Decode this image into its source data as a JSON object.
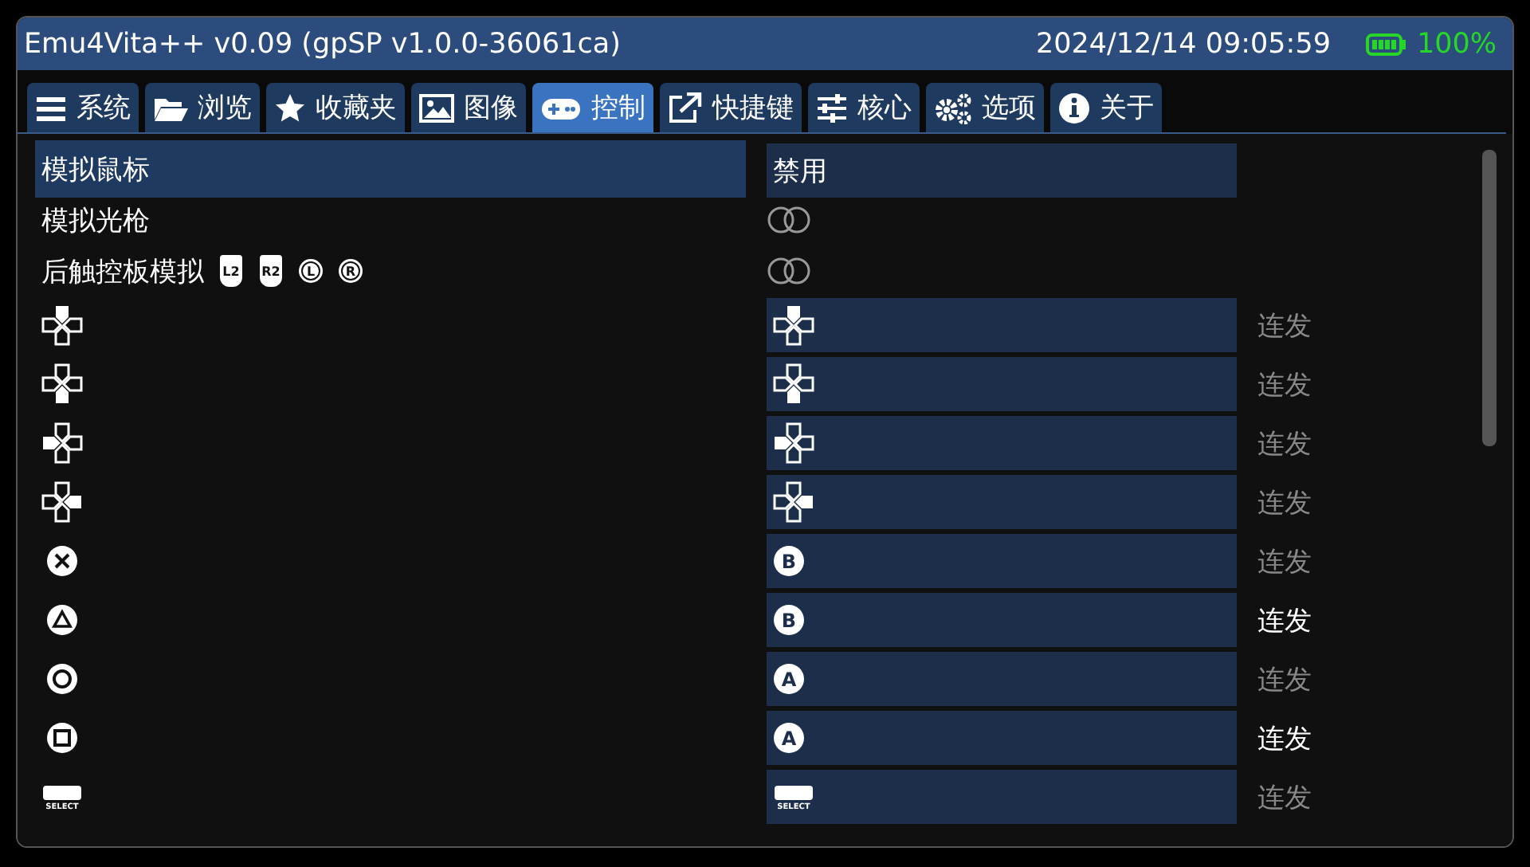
{
  "window": {
    "title": "Emu4Vita++ v0.09 (gpSP v1.0.0-36061ca)",
    "datetime": "2024/12/14 09:05:59",
    "battery": "100%"
  },
  "tabs": [
    {
      "label": "系统",
      "kind": "menu",
      "selected": false
    },
    {
      "label": "浏览",
      "kind": "folder",
      "selected": false
    },
    {
      "label": "收藏夹",
      "kind": "star",
      "selected": false
    },
    {
      "label": "图像",
      "kind": "image",
      "selected": false
    },
    {
      "label": "控制",
      "kind": "gamepad",
      "selected": true
    },
    {
      "label": "快捷键",
      "kind": "external",
      "selected": false
    },
    {
      "label": "核心",
      "kind": "sliders",
      "selected": false
    },
    {
      "label": "选项",
      "kind": "gears",
      "selected": false
    },
    {
      "label": "关于",
      "kind": "info",
      "selected": false
    }
  ],
  "settings": [
    {
      "kind": "option",
      "label": "模拟鼠标",
      "value": "禁用",
      "selected": true
    },
    {
      "kind": "toggle",
      "label": "模拟光枪",
      "on": false,
      "selected": false
    },
    {
      "kind": "toggle",
      "label": "后触控板模拟",
      "on": false,
      "selected": false,
      "buttons": [
        {
          "kind": "shoulder",
          "glyph": "L2"
        },
        {
          "kind": "shoulder",
          "glyph": "R2"
        },
        {
          "kind": "ring",
          "glyph": "L"
        },
        {
          "kind": "ring",
          "glyph": "R"
        }
      ]
    }
  ],
  "mappings": [
    {
      "source": {
        "kind": "dpad-up"
      },
      "target": {
        "kind": "dpad-up"
      },
      "turbo_label": "连发",
      "turbo": false
    },
    {
      "source": {
        "kind": "dpad-down"
      },
      "target": {
        "kind": "dpad-down"
      },
      "turbo_label": "连发",
      "turbo": false
    },
    {
      "source": {
        "kind": "dpad-left"
      },
      "target": {
        "kind": "dpad-left"
      },
      "turbo_label": "连发",
      "turbo": false
    },
    {
      "source": {
        "kind": "dpad-right"
      },
      "target": {
        "kind": "dpad-right"
      },
      "turbo_label": "连发",
      "turbo": false
    },
    {
      "source": {
        "kind": "cross"
      },
      "target": {
        "kind": "letter",
        "glyph": "B"
      },
      "turbo_label": "连发",
      "turbo": false
    },
    {
      "source": {
        "kind": "triangle"
      },
      "target": {
        "kind": "letter",
        "glyph": "B"
      },
      "turbo_label": "连发",
      "turbo": true
    },
    {
      "source": {
        "kind": "circle"
      },
      "target": {
        "kind": "letter",
        "glyph": "A"
      },
      "turbo_label": "连发",
      "turbo": false
    },
    {
      "source": {
        "kind": "square"
      },
      "target": {
        "kind": "letter",
        "glyph": "A"
      },
      "turbo_label": "连发",
      "turbo": true
    },
    {
      "source": {
        "kind": "select",
        "glyph": "SELECT"
      },
      "target": {
        "kind": "select",
        "glyph": "SELECT"
      },
      "turbo_label": "连发",
      "turbo": false
    }
  ]
}
